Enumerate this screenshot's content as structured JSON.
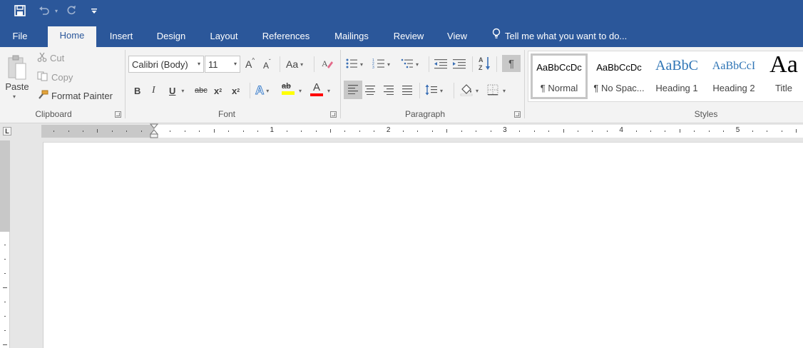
{
  "quick_access": {
    "save_icon": "save-icon",
    "undo_icon": "undo-icon",
    "redo_icon": "redo-icon",
    "customize_icon": "customize-qat-icon"
  },
  "tabs": [
    {
      "label": "File"
    },
    {
      "label": "Home"
    },
    {
      "label": "Insert"
    },
    {
      "label": "Design"
    },
    {
      "label": "Layout"
    },
    {
      "label": "References"
    },
    {
      "label": "Mailings"
    },
    {
      "label": "Review"
    },
    {
      "label": "View"
    }
  ],
  "tell_me": "Tell me what you want to do...",
  "clipboard": {
    "paste": "Paste",
    "cut": "Cut",
    "copy": "Copy",
    "format_painter": "Format Painter",
    "group_label": "Clipboard"
  },
  "font": {
    "font_name": "Calibri (Body)",
    "font_size": "11",
    "grow": "A",
    "shrink": "A",
    "change_case": "Aa",
    "bold": "B",
    "italic": "I",
    "underline": "U",
    "strikethrough": "abc",
    "subscript": "x",
    "superscript": "x",
    "sub_mark": "2",
    "sup_mark": "2",
    "text_effects": "A",
    "highlight": "ab",
    "font_color": "A",
    "group_label": "Font",
    "highlight_color": "#ffff00",
    "font_color_value": "#ff0000"
  },
  "paragraph": {
    "group_label": "Paragraph",
    "sort": "A↓"
  },
  "styles": {
    "group_label": "Styles",
    "items": [
      {
        "sample": "AaBbCcDc",
        "name": "¶ Normal"
      },
      {
        "sample": "AaBbCcDc",
        "name": "¶ No Spac..."
      },
      {
        "sample": "AaBbC",
        "name": "Heading 1"
      },
      {
        "sample": "AaBbCcI",
        "name": "Heading 2"
      },
      {
        "sample": "Aa",
        "name": "Title"
      }
    ]
  },
  "ruler": {
    "tab_selector": "L",
    "numbers": [
      "1",
      "2",
      "3",
      "4",
      "5"
    ]
  },
  "colors": {
    "brand": "#2b579a",
    "ribbon_bg": "#f3f3f3",
    "heading_blue": "#2e74b5"
  }
}
